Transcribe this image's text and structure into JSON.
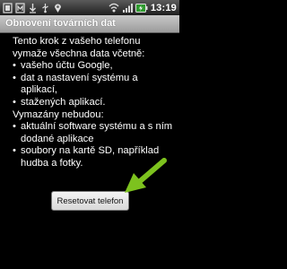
{
  "status_bar": {
    "time": "13:19",
    "icons": [
      "notification-icon",
      "sync-icon",
      "alarm-icon",
      "usb-icon",
      "location-icon",
      "wifi-icon",
      "signal-icon",
      "battery-icon"
    ]
  },
  "dialog": {
    "title": "Obnovení továrních dat",
    "intro": "Tento krok z vašeho telefonu vymaže všechna data včetně:",
    "erase_items": [
      "vašeho účtu Google,",
      "dat a nastavení systému a aplikací,",
      "stažených aplikací."
    ],
    "keep_heading": "Vymazány nebudou:",
    "keep_items": [
      "aktuální software systému a s ním dodané aplikace",
      "soubory na kartě SD, například hudba a fotky."
    ],
    "reset_button_label": "Resetovat telefon"
  },
  "colors": {
    "arrow": "#7dc21e",
    "background": "#000000"
  }
}
